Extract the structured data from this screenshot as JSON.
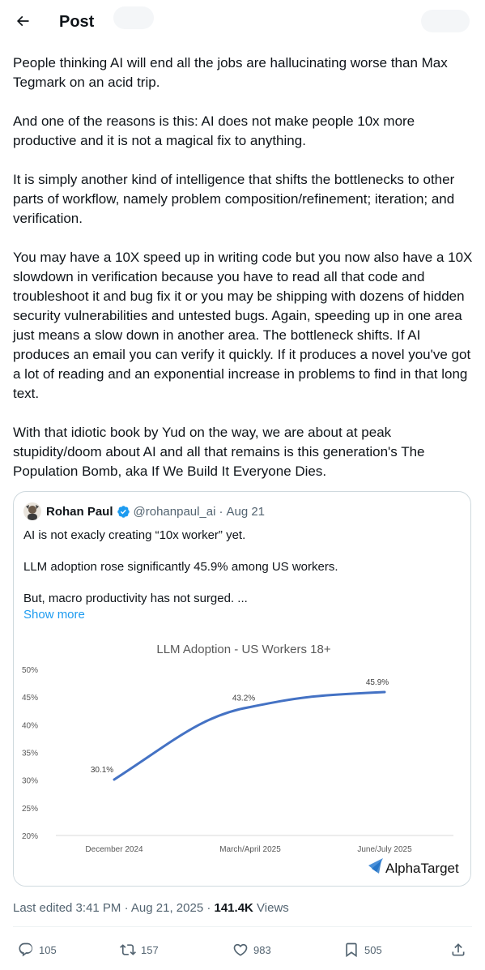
{
  "header": {
    "title": "Post",
    "back_icon": "arrow-left-icon"
  },
  "post": {
    "paragraphs": [
      "People thinking AI will end all the jobs are hallucinating worse than Max Tegmark on an acid trip.",
      "And one of the reasons is this: AI does not make people 10x more productive and it is not a magical fix to anything.",
      "It is simply another kind of intelligence that shifts the bottlenecks to other parts of workflow, namely problem composition/refinement; iteration; and verification.",
      "You may have a 10X speed up in writing code but you now also have a 10X slowdown in verification because you have to read all that code and troubleshoot it and bug fix it or you may be shipping with dozens of hidden security vulnerabilities and untested bugs. Again, speeding up in one area just means a slow down in another area. The bottleneck shifts. If AI produces an email you can verify it quickly. If it produces a novel you've got a lot of reading and an exponential increase in problems to find in that long text.",
      "With that idiotic book by Yud on the way, we are about at peak stupidity/doom about AI and all that remains is this generation's The Population Bomb, aka If We Build It Everyone Dies."
    ]
  },
  "quote": {
    "name": "Rohan Paul",
    "handle": "@rohanpaul_ai",
    "separator": "·",
    "date": "Aug 21",
    "lines": [
      "AI is not exacly creating “10x worker” yet.",
      "LLM adoption rose significantly 45.9% among US workers.",
      "But, macro productivity has not surged. ..."
    ],
    "show_more": "Show more",
    "watermark": "AlphaTarget"
  },
  "chart_data": {
    "type": "line",
    "title": "LLM Adoption - US Workers 18+",
    "categories": [
      "December 2024",
      "March/April 2025",
      "June/July 2025"
    ],
    "series": [
      {
        "values": [
          30.1,
          43.2,
          45.9
        ]
      }
    ],
    "data_labels": [
      "30.1%",
      "43.2%",
      "45.9%"
    ],
    "y_ticks": [
      "50%",
      "45%",
      "40%",
      "35%",
      "30%",
      "25%",
      "20%"
    ],
    "ylim": [
      20,
      50
    ],
    "line_color": "#4472c4",
    "grid": false
  },
  "meta": {
    "edited": "Last edited 3:41 PM · Aug 21, 2025 · ",
    "views_count": "141.4K",
    "views_label": " Views"
  },
  "actions": {
    "replies": "105",
    "reposts": "157",
    "likes": "983",
    "bookmarks": "505"
  },
  "colors": {
    "link": "#1d9bf0",
    "secondary": "#536471",
    "border": "#cfd9de"
  }
}
